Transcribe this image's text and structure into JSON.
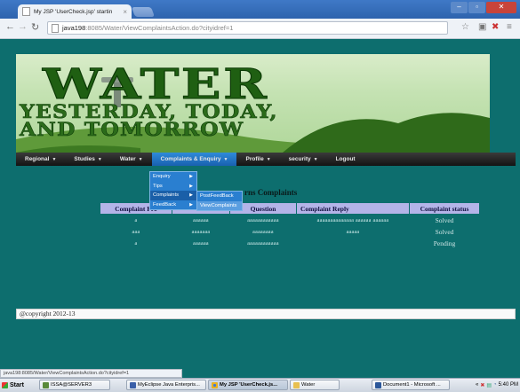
{
  "browser": {
    "tab_title": "My JSP 'UserCheck.jsp' startin",
    "url_host": "java198",
    "url_rest": ":8085/Water/ViewComplaintsAction.do?cityidref=1",
    "status_url": "java198:8085/Water/ViewComplaintsAction.do?cityidref=1"
  },
  "banner": {
    "logo": "WATER",
    "tagline_line1": "YESTERDAY, TODAY,",
    "tagline_line2": "AND TOMORROW"
  },
  "menu": {
    "items": [
      {
        "label": "Regional"
      },
      {
        "label": "Studies"
      },
      {
        "label": "Water"
      },
      {
        "label": "Complaints & Enquiry",
        "active": true
      },
      {
        "label": "Profile"
      },
      {
        "label": "security"
      },
      {
        "label": "Logout"
      }
    ],
    "dropdown": [
      "Enquiry",
      "Tips",
      "Complaints",
      "FeedBack"
    ],
    "submenu": [
      "PostFeedBack",
      "ViewComplaints"
    ]
  },
  "table": {
    "title_fragment": "rns Complaints",
    "headers": [
      "Complaint Fro",
      "",
      "Question",
      "Complaint Reply",
      "Complaint status"
    ],
    "rows": [
      [
        "a",
        "aaaaaa",
        "aaaaaaaaaaaa",
        "aaaaaaaaaaaaaa aaaaaa aaaaaa",
        "Solved"
      ],
      [
        "aaa",
        "aaaaaaa",
        "aaaaaaaa",
        "aaaaa",
        "Solved"
      ],
      [
        "a",
        "aaaaaa",
        "aaaaaaaaaaaa",
        "",
        "Pending"
      ]
    ]
  },
  "footer": {
    "text": "@copyright 2012-13"
  },
  "taskbar": {
    "start": "Start",
    "tasks": [
      "ISSA@SERVER3",
      "MyEclipse Java Enterpris...",
      "My JSP 'UserCheck.js...",
      "Water",
      "Document1 - Microsoft ..."
    ],
    "clock": "5:40 PM"
  },
  "colors": {
    "page_bg": "#0d6e6e",
    "menu_active": "#2f8ad8",
    "table_header": "#b4b4e8"
  }
}
